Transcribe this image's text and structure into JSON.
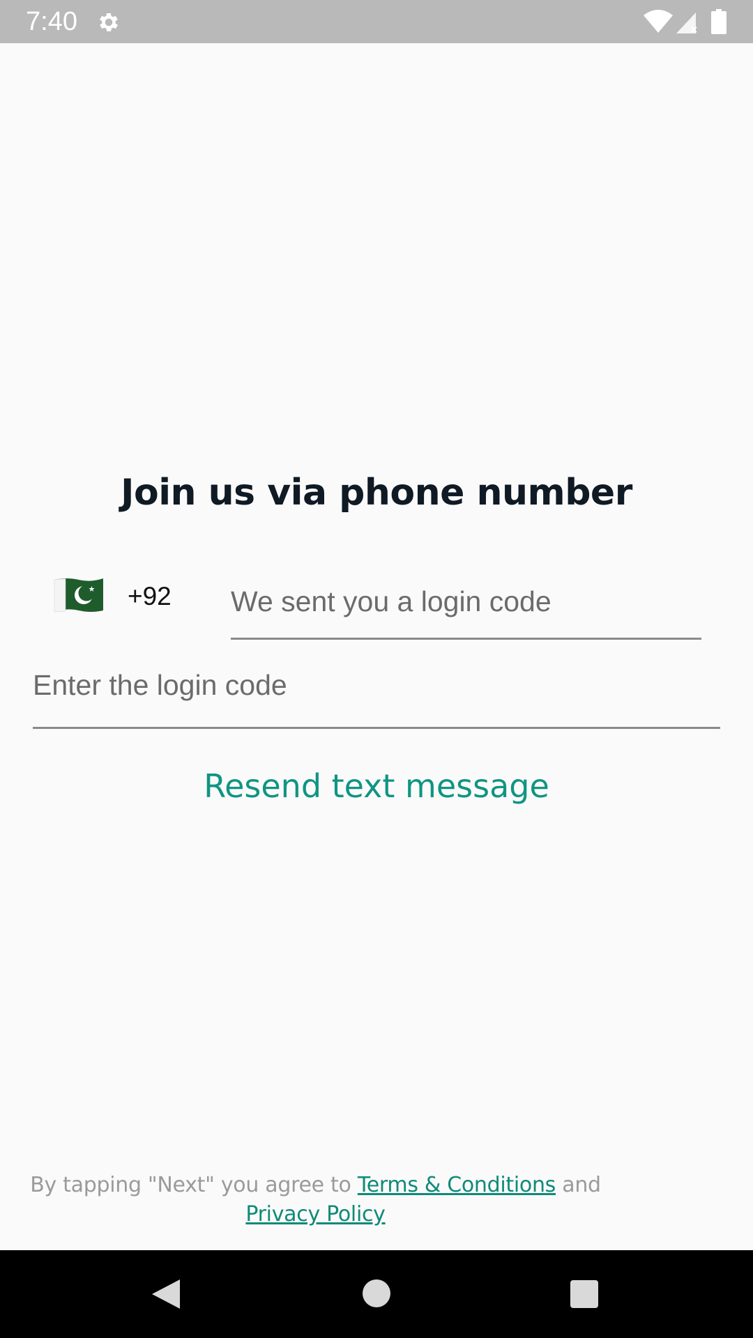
{
  "status_bar": {
    "time": "7:40",
    "icons": [
      "gear-icon",
      "wifi-icon",
      "signal-icon",
      "battery-icon"
    ]
  },
  "title": "Join us via phone number",
  "phone": {
    "country_flag": "pakistan-flag-icon",
    "country_code": "+92",
    "placeholder": "We sent you a login code"
  },
  "login_code": {
    "placeholder": "Enter the login code"
  },
  "resend_label": "Resend text message",
  "legal": {
    "prefix": "By tapping \"Next\" you agree to ",
    "terms_label": "Terms & Conditions",
    "conjunction": " and",
    "privacy_label": "Privacy Policy"
  },
  "colors": {
    "accent": "#0f9582",
    "link": "#0f8a78",
    "title": "#0f1a24",
    "status_bar": "#b9b9b9",
    "background": "#fafafa"
  },
  "nav_bar": {
    "icons": [
      "back-icon",
      "home-icon",
      "recents-icon"
    ]
  }
}
